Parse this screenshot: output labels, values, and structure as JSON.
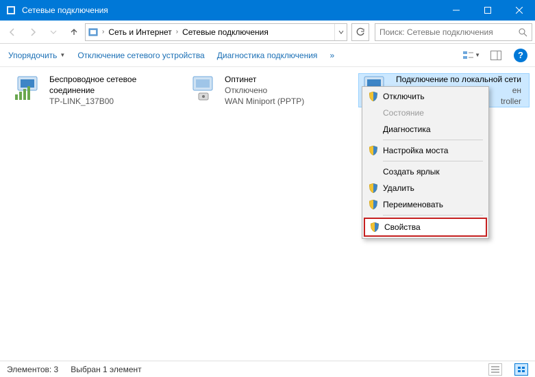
{
  "window": {
    "title": "Сетевые подключения"
  },
  "breadcrumb": {
    "seg1": "Сеть и Интернет",
    "seg2": "Сетевые подключения"
  },
  "search": {
    "placeholder": "Поиск: Сетевые подключения"
  },
  "toolbar": {
    "organize": "Упорядочить",
    "disable": "Отключение сетевого устройства",
    "diagnose": "Диагностика подключения",
    "more": "»"
  },
  "connections": {
    "c1": {
      "name": "Беспроводное сетевое",
      "line2": "соединение",
      "line3": "TP-LINK_137B00"
    },
    "c2": {
      "name": "Оптинет",
      "line2": "Отключено",
      "line3": "WAN Miniport (PPTP)"
    },
    "c3": {
      "name": "Подключение по локальной сети",
      "line2": "ен",
      "line3": "troller"
    }
  },
  "context_menu": {
    "disable": "Отключить",
    "status": "Состояние",
    "diag": "Диагностика",
    "bridge": "Настройка моста",
    "shortcut": "Создать ярлык",
    "delete": "Удалить",
    "rename": "Переименовать",
    "props": "Свойства"
  },
  "statusbar": {
    "count": "Элементов: 3",
    "selected": "Выбран 1 элемент"
  }
}
